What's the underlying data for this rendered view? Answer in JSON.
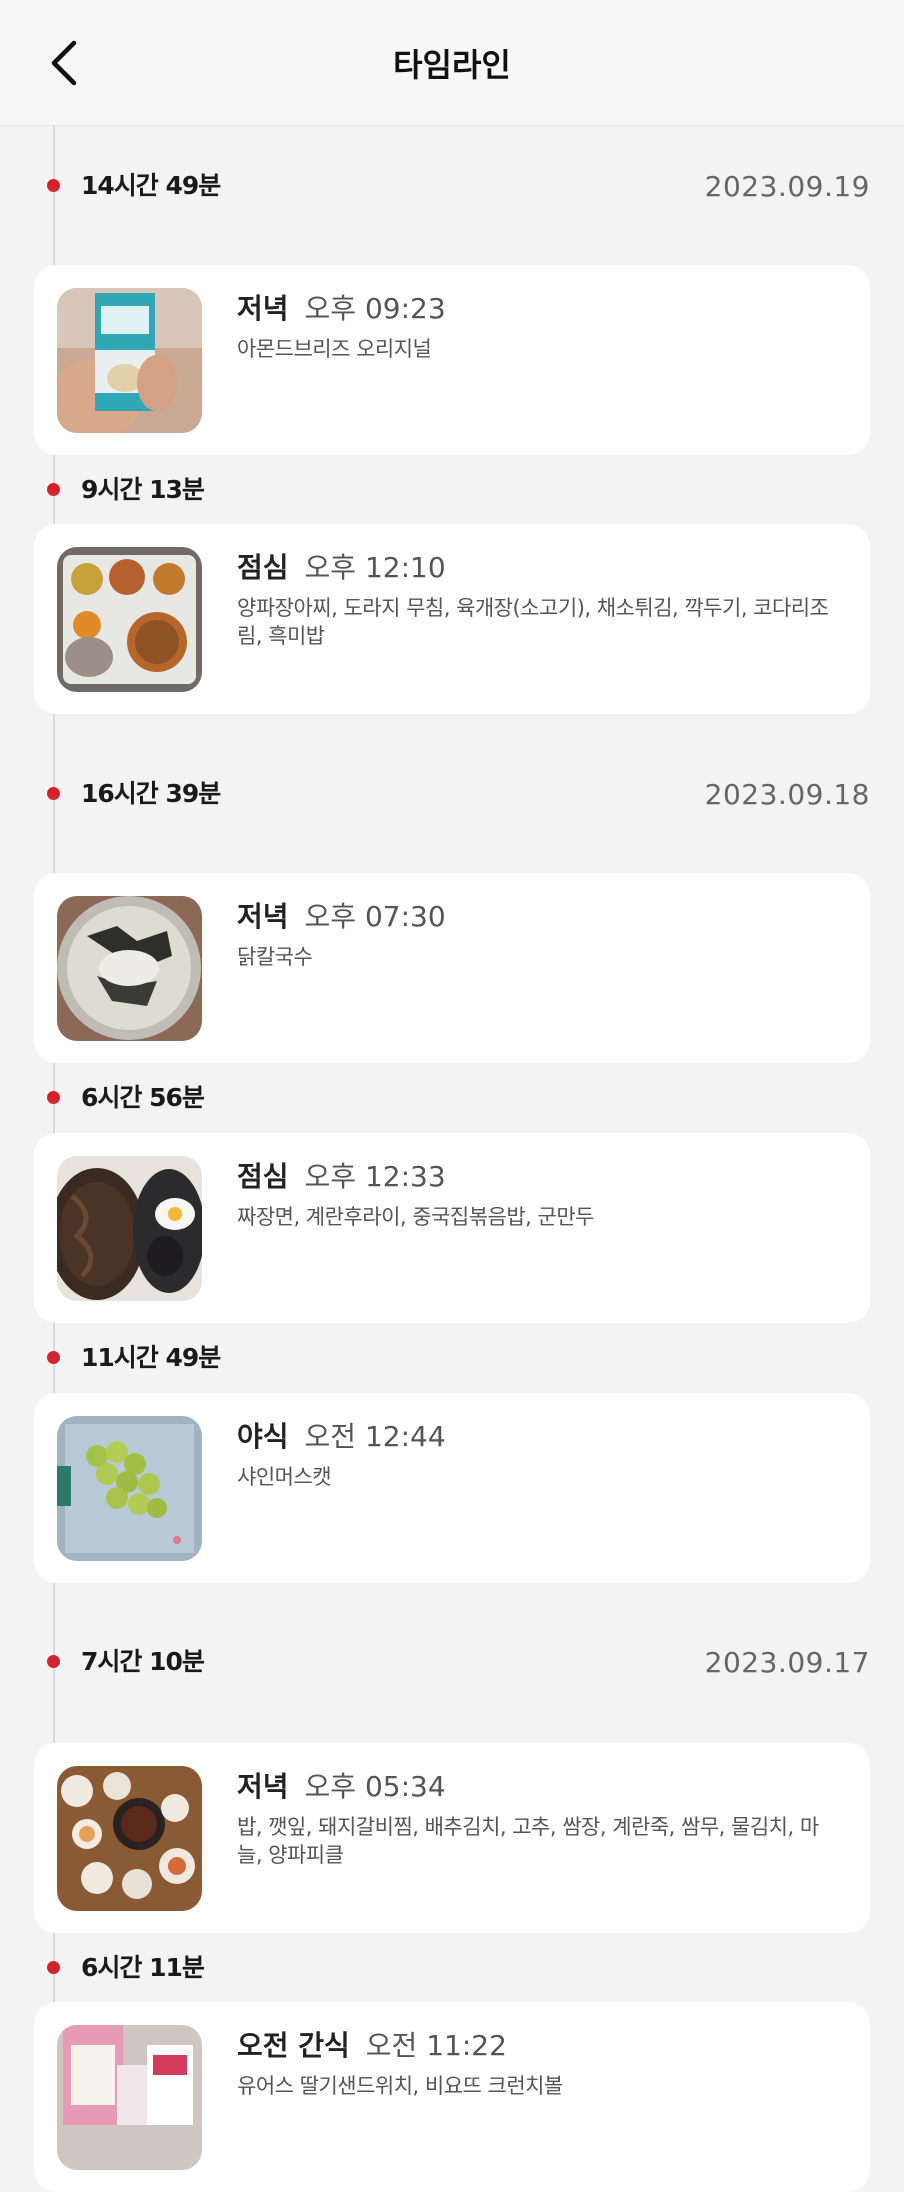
{
  "header": {
    "title": "타임라인"
  },
  "timeline": {
    "gaps": [
      "14시간 49분",
      "9시간 13분",
      "16시간 39분",
      "6시간 56분",
      "11시간 49분",
      "7시간 10분",
      "6시간 11분"
    ],
    "dates": [
      "2023.09.19",
      "2023.09.18",
      "2023.09.17"
    ],
    "meals": [
      {
        "type": "저녁",
        "time": "오후 09:23",
        "items": "아몬드브리즈 오리지널"
      },
      {
        "type": "점심",
        "time": "오후 12:10",
        "items": "양파장아찌, 도라지 무침, 육개장(소고기), 채소튀김, 깍두기, 코다리조림, 흑미밥"
      },
      {
        "type": "저녁",
        "time": "오후 07:30",
        "items": "닭칼국수"
      },
      {
        "type": "점심",
        "time": "오후 12:33",
        "items": "짜장면, 계란후라이, 중국집볶음밥, 군만두"
      },
      {
        "type": "야식",
        "time": "오전 12:44",
        "items": "샤인머스캣"
      },
      {
        "type": "저녁",
        "time": "오후 05:34",
        "items": "밥, 깻잎, 돼지갈비찜, 배추김치, 고추, 쌈장, 계란죽, 쌈무, 물김치, 마늘, 양파피클"
      },
      {
        "type": "오전 간식",
        "time": "오전 11:22",
        "items": "유어스 딸기샌드위치, 비요뜨 크런치볼"
      }
    ]
  },
  "colors": {
    "accent": "#d2232f",
    "background": "#f3f3f4",
    "card": "#ffffff"
  },
  "icons": {
    "back": "chevron-left-icon"
  }
}
